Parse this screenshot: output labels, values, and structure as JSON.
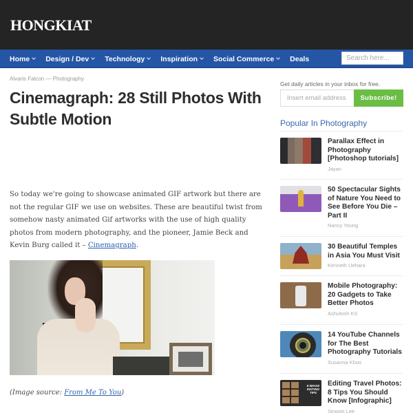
{
  "header": {
    "logo": "HONGKIAT"
  },
  "nav": {
    "items": [
      {
        "label": "Home",
        "has_dropdown": true
      },
      {
        "label": "Design / Dev",
        "has_dropdown": true
      },
      {
        "label": "Technology",
        "has_dropdown": true
      },
      {
        "label": "Inspiration",
        "has_dropdown": true
      },
      {
        "label": "Social Commerce",
        "has_dropdown": true
      },
      {
        "label": "Deals",
        "has_dropdown": false
      }
    ],
    "search_placeholder": "Search here..."
  },
  "article": {
    "meta": "Alvaris Falcon — Photography",
    "title": "Cinemagraph: 28 Still Photos With Subtle Motion",
    "intro_text": "So today we're going to showcase animated GIF artwork but there are not the regular GIF we use on websites. These are beautiful twist from somehow nasty animated Gif artworks with the use of high quality photos from modern photography, and the pioneer, Jamie Beck and Kevin Burg called it – ",
    "intro_link": "Cinemagraph",
    "intro_end": ".",
    "image_alt": "Woman seated before a gilded mirror frame",
    "caption_prefix": "(Image source: ",
    "caption_link": "From Me To You",
    "caption_suffix": ")"
  },
  "sidebar": {
    "newsletter_note": "Get daily articles in your inbox for free.",
    "email_placeholder": "Insert email address",
    "subscribe_label": "Subscribe!",
    "popular_title": "Popular In Photography",
    "popular": [
      {
        "title": "Parallax Effect in Photography [Photoshop tutorials]",
        "author": "Jayan"
      },
      {
        "title": "50 Spectacular Sights of Nature You Need to See Before You Die – Part II",
        "author": "Nancy Young"
      },
      {
        "title": "30 Beautiful Temples in Asia You Must Visit",
        "author": "Kenneth Uehara"
      },
      {
        "title": "Mobile Photography: 20 Gadgets to Take Better Photos",
        "author": "Ashutosh KS"
      },
      {
        "title": "14 YouTube Channels for The Best Photography Tutorials",
        "author": "Susanna Khoo"
      },
      {
        "title": "Editing Travel Photos: 8 Tips You Should Know [Infographic]",
        "author": "Singyin Lee"
      }
    ],
    "thumb6_text": "8 IMAGE EDITING TIPS"
  },
  "colors": {
    "header_bg": "#242424",
    "nav_bg": "#2556a6",
    "subscribe_bg": "#6bbd45",
    "link": "#2b5fb0",
    "popular_title": "#3a67b0"
  }
}
